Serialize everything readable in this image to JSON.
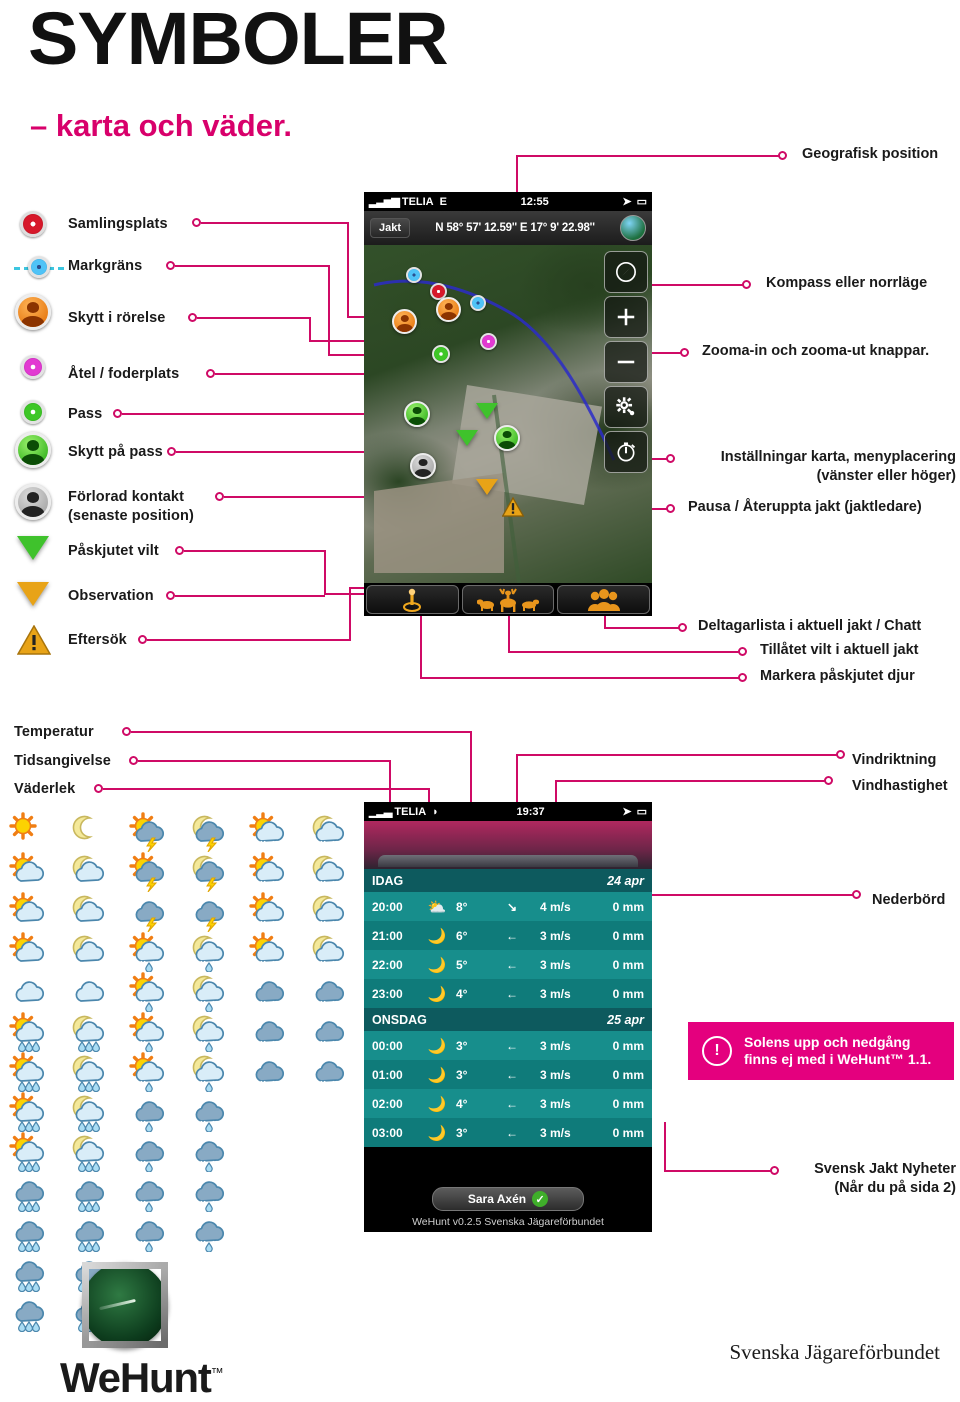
{
  "header": {
    "title": "SYMBOLER",
    "subtitle": "– karta och väder."
  },
  "colors": {
    "accent_pink": "#cf0a66",
    "note_pink": "#e4007e",
    "subtitle_pink": "#d8006b"
  },
  "legend": {
    "items": [
      {
        "label": "Samlingsplats",
        "icon": "red-dot-marker-icon"
      },
      {
        "label": "Markgräns",
        "icon": "blue-dot-boundary-icon"
      },
      {
        "label": "Skytt i rörelse",
        "icon": "orange-hunter-icon"
      },
      {
        "label": "Åtel / foderplats",
        "icon": "magenta-dot-marker-icon"
      },
      {
        "label": "Pass",
        "icon": "green-dot-marker-icon"
      },
      {
        "label": "Skytt på pass",
        "icon": "green-hunter-icon"
      },
      {
        "label": "Förlorad kontakt",
        "label2": "(senaste position)",
        "icon": "grey-hunter-icon"
      },
      {
        "label": "Påskjutet vilt",
        "icon": "green-triangle-icon"
      },
      {
        "label": "Observation",
        "icon": "amber-triangle-icon"
      },
      {
        "label": "Eftersök",
        "icon": "warning-triangle-icon"
      }
    ]
  },
  "right_labels": {
    "geo_position": "Geografisk position",
    "compass": "Kompass eller norrläge",
    "zoom_buttons": "Zooma-in och zooma-ut knappar.",
    "map_settings_line1": "Inställningar karta, menyplacering",
    "map_settings_line2": "(vänster eller höger)",
    "pause_hunt": "Pausa / Återuppta jakt (jaktledare)",
    "participants": "Deltagarlista i aktuell jakt / Chatt",
    "allowed_game": "Tillåtet vilt i aktuell jakt",
    "mark_shot_animal": "Markera påskjutet djur",
    "wind_direction": "Vindriktning",
    "wind_speed": "Vindhastighet",
    "precipitation": "Nederbörd",
    "news_line1": "Svensk Jakt Nyheter",
    "news_line2": "(Når du på sida 2)"
  },
  "weather_labels": {
    "temperature": "Temperatur",
    "time": "Tidsangivelse",
    "conditions": "Väderlek"
  },
  "map_phone": {
    "status": {
      "carrier": "TELIA",
      "network": "E",
      "time": "12:55",
      "signal_icon": "signal-bars-icon",
      "location_icon": "location-arrow-icon",
      "battery_icon": "battery-icon"
    },
    "hunt_button": "Jakt",
    "coordinates": "N 58° 57' 12.59'' E 17° 9' 22.98''",
    "globe_icon": "globe-icon",
    "controls": [
      {
        "name": "compass-button",
        "icon": "compass-icon"
      },
      {
        "name": "zoom-in-button",
        "icon": "plus-icon"
      },
      {
        "name": "zoom-out-button",
        "icon": "minus-icon"
      },
      {
        "name": "settings-button",
        "icon": "gear-icon"
      },
      {
        "name": "pause-hunt-button",
        "icon": "stopwatch-icon"
      }
    ],
    "toolbar": [
      {
        "name": "mark-shot-animal-button",
        "icon": "shot-marker-icon"
      },
      {
        "name": "allowed-game-button",
        "icon": "animals-icon"
      },
      {
        "name": "participants-button",
        "icon": "people-icon"
      }
    ]
  },
  "weather_phone": {
    "status": {
      "carrier": "TELIA",
      "network": "wifi",
      "time": "19:37"
    },
    "days": [
      {
        "name": "IDAG",
        "date": "24 apr",
        "rows": [
          {
            "time": "20:00",
            "icon": "sun-cloud-icon",
            "temp": "8°",
            "dir": "arrow-sw-icon",
            "wind": "4 m/s",
            "precip": "0 mm"
          },
          {
            "time": "21:00",
            "icon": "moon-cloud-icon",
            "temp": "6°",
            "dir": "arrow-west-icon",
            "wind": "3 m/s",
            "precip": "0 mm"
          },
          {
            "time": "22:00",
            "icon": "moon-cloud-icon",
            "temp": "5°",
            "dir": "arrow-west-icon",
            "wind": "3 m/s",
            "precip": "0 mm"
          },
          {
            "time": "23:00",
            "icon": "moon-cloud-icon",
            "temp": "4°",
            "dir": "arrow-west-icon",
            "wind": "3 m/s",
            "precip": "0 mm"
          }
        ]
      },
      {
        "name": "ONSDAG",
        "date": "25 apr",
        "rows": [
          {
            "time": "00:00",
            "icon": "moon-icon",
            "temp": "3°",
            "dir": "arrow-west-icon",
            "wind": "3 m/s",
            "precip": "0 mm"
          },
          {
            "time": "01:00",
            "icon": "moon-cloud-icon",
            "temp": "3°",
            "dir": "arrow-west-icon",
            "wind": "3 m/s",
            "precip": "0 mm"
          },
          {
            "time": "02:00",
            "icon": "moon-icon",
            "temp": "4°",
            "dir": "arrow-west-icon",
            "wind": "3 m/s",
            "precip": "0 mm"
          },
          {
            "time": "03:00",
            "icon": "moon-cloud-icon",
            "temp": "3°",
            "dir": "arrow-west-icon",
            "wind": "3 m/s",
            "precip": "0 mm"
          }
        ]
      }
    ],
    "user": "Sara Axén",
    "user_check_icon": "check-circle-icon",
    "version": "WeHunt v0.2.5 Svenska Jägareförbundet"
  },
  "weather_icon_grid": {
    "columns": [
      {
        "name": "day-conditions",
        "count": 13,
        "kinds": [
          "sun",
          "sun-cloud",
          "sun-cloud2",
          "sun-cloud3",
          "cloud",
          "sun-rain",
          "sun-rain2",
          "sun-rain3",
          "sun-rain4",
          "rain",
          "rain2",
          "rain3",
          "rain4"
        ]
      },
      {
        "name": "night-conditions",
        "count": 13,
        "kinds": [
          "moon",
          "moon-cloud",
          "moon-cloud2",
          "moon-cloud3",
          "cloud",
          "moon-rain",
          "moon-rain2",
          "moon-rain3",
          "moon-rain4",
          "rain",
          "rain2",
          "rain3",
          "rain4"
        ]
      },
      {
        "name": "day-thunder-sleet",
        "count": 11,
        "kinds": [
          "sun-thunder",
          "sun-thunder2",
          "thunder",
          "sun-sleet",
          "sun-sleet2",
          "sun-sleet3",
          "sun-sleet4",
          "sleet",
          "sleet2",
          "sleet3",
          "sleet4"
        ]
      },
      {
        "name": "night-thunder-sleet",
        "count": 11,
        "kinds": [
          "moon-thunder",
          "moon-thunder2",
          "thunder",
          "moon-sleet",
          "moon-sleet2",
          "moon-sleet3",
          "moon-sleet4",
          "sleet",
          "sleet2",
          "sleet3",
          "sleet4"
        ]
      },
      {
        "name": "day-snow",
        "count": 7,
        "kinds": [
          "sun-snow",
          "sun-snow2",
          "sun-snow3",
          "sun-snow4",
          "snow",
          "snow2",
          "snow3"
        ]
      },
      {
        "name": "night-snow",
        "count": 7,
        "kinds": [
          "moon-snow",
          "moon-snow2",
          "moon-snow3",
          "moon-snow4",
          "snow",
          "snow2",
          "snow3"
        ]
      }
    ]
  },
  "note": {
    "icon": "exclamation-circle-icon",
    "line1": "Solens upp och nedgång",
    "line2": "finns ej med  i WeHunt™ 1.1."
  },
  "footer": {
    "logo_icon": "wehunt-radar-logo-icon",
    "brand": "WeHunt",
    "trademark": "™",
    "organisation": "Svenska Jägareförbundet"
  }
}
